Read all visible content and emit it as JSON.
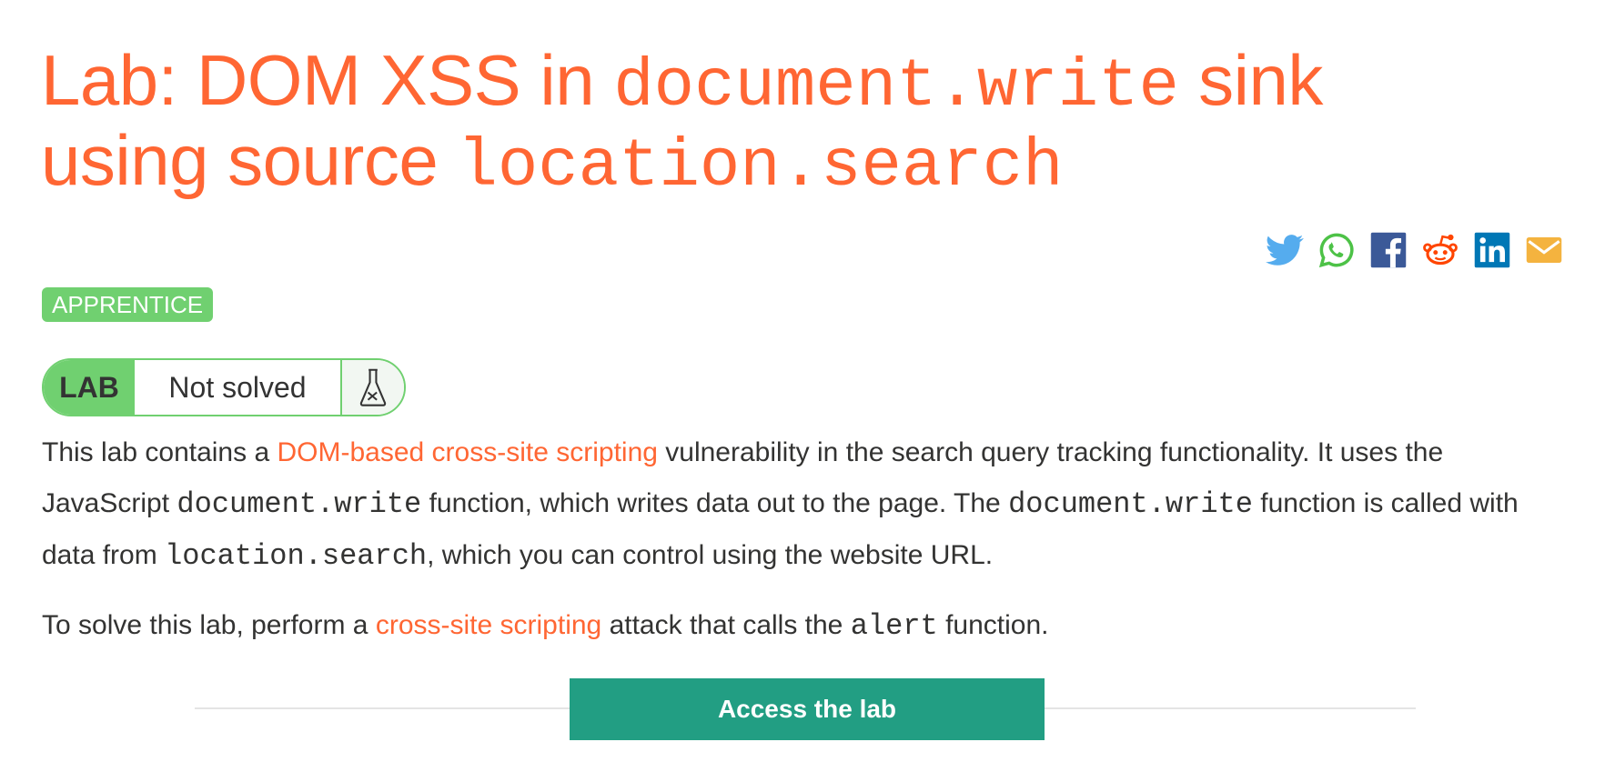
{
  "title": {
    "part1": "Lab: DOM XSS in ",
    "code1": "document.write",
    "part2": " sink",
    "part3": "using source ",
    "code2": "location.search"
  },
  "share": {
    "icons": [
      "twitter-icon",
      "whatsapp-icon",
      "facebook-icon",
      "reddit-icon",
      "linkedin-icon",
      "email-icon"
    ],
    "colors": {
      "twitter": "#55acee",
      "whatsapp": "#4dc247",
      "facebook": "#3b5998",
      "reddit": "#ff4500",
      "linkedin": "#0077b5",
      "email": "#f4b33f"
    }
  },
  "level": {
    "label": "APPRENTICE",
    "color": "#70d070"
  },
  "lab_status": {
    "tag": "LAB",
    "state": "Not solved",
    "icon": "flask-icon"
  },
  "description": {
    "p1": {
      "t1": "This lab contains a ",
      "link1": "DOM-based cross-site scripting",
      "t2": " vulnerability in the search query tracking functionality. It uses the JavaScript ",
      "code1": "document.write",
      "t3": " function, which writes data out to the page. The ",
      "code2": "document.write",
      "t4": " function is called with data from ",
      "code3": "location.search",
      "t5": ", which you can control using the website URL."
    },
    "p2": {
      "t1": "To solve this lab, perform a ",
      "link1": "cross-site scripting",
      "t2": " attack that calls the ",
      "code1": "alert",
      "t3": " function."
    }
  },
  "access_button": {
    "label": "Access the lab",
    "color": "#229e83"
  },
  "accent_color": "#ff6633"
}
